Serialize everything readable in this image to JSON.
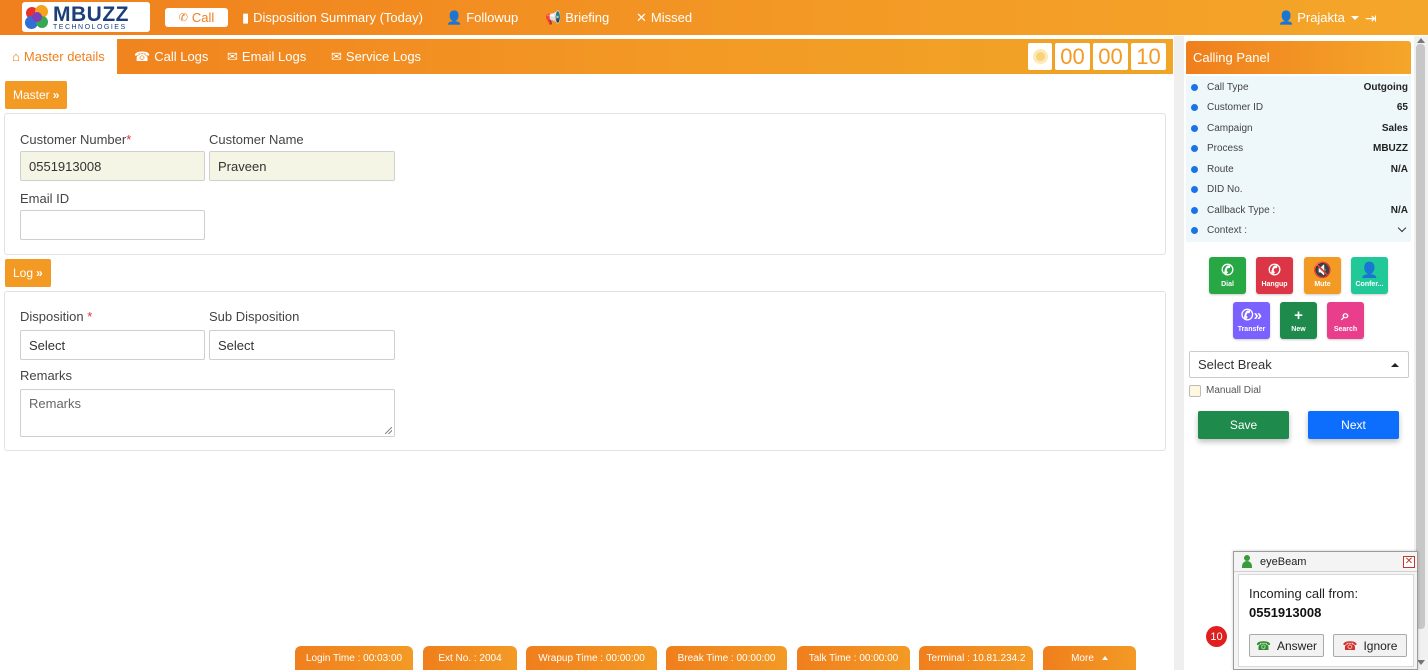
{
  "topbar": {
    "logo_big": "MBUZZ",
    "logo_small": "TECHNOLOGIES",
    "call_label": "Call",
    "nav": {
      "disposition_summary": "Disposition Summary (Today)",
      "followup": "Followup",
      "briefing": "Briefing",
      "missed": "Missed"
    },
    "user_name": "Prajakta"
  },
  "tabs": {
    "master_details": "Master details",
    "call_logs": "Call Logs",
    "email_logs": "Email Logs",
    "service_logs": "Service Logs"
  },
  "timer": {
    "h": "00",
    "m": "00",
    "s": "10"
  },
  "master": {
    "section_label": "Master",
    "customer_number_label": "Customer Number",
    "customer_number_value": "0551913008",
    "customer_name_label": "Customer Name",
    "customer_name_value": "Praveen",
    "email_label": "Email ID",
    "email_value": ""
  },
  "log": {
    "section_label": "Log",
    "disposition_label": "Disposition",
    "disposition_value": "Select",
    "sub_disposition_label": "Sub Disposition",
    "sub_disposition_value": "Select",
    "remarks_label": "Remarks",
    "remarks_placeholder": "Remarks"
  },
  "calling_panel": {
    "title": "Calling Panel",
    "rows": [
      {
        "key": "Call Type",
        "value": "Outgoing"
      },
      {
        "key": "Customer ID",
        "value": "65"
      },
      {
        "key": "Campaign",
        "value": "Sales"
      },
      {
        "key": "Process",
        "value": "MBUZZ"
      },
      {
        "key": "Route",
        "value": "N/A"
      },
      {
        "key": "DID No.",
        "value": ""
      },
      {
        "key": "Callback Type :",
        "value": "N/A"
      },
      {
        "key": "Context :",
        "value": ""
      }
    ],
    "actions": {
      "dial": "Dial",
      "hangup": "Hangup",
      "mute": "Mute",
      "conference": "Confer...",
      "transfer": "Transfer",
      "new": "New",
      "search": "Search"
    },
    "colors": {
      "dial": "#28a745",
      "hangup": "#dc3545",
      "mute": "#f39a25",
      "conference": "#20c997",
      "transfer": "#7b61ff",
      "new": "#1e8a4c",
      "search": "#e83e8c"
    },
    "break_select": "Select Break",
    "manual_dial_label": "Manuall Dial",
    "save_label": "Save",
    "next_label": "Next"
  },
  "eyebeam": {
    "title": "eyeBeam",
    "incoming_label": "Incoming call from:",
    "number": "0551913008",
    "answer_label": "Answer",
    "ignore_label": "Ignore",
    "badge_count": "10"
  },
  "status_bar": {
    "login_time": "Login Time : 00:03:00",
    "ext_no": "Ext No. : 2004",
    "wrapup_time": "Wrapup Time : 00:00:00",
    "break_time": "Break Time : 00:00:00",
    "talk_time": "Talk Time : 00:00:00",
    "terminal": "Terminal : 10.81.234.2",
    "more": "More"
  },
  "theme": {
    "accent": "#f39a25",
    "save": "#1e8a4c",
    "next": "#0d6efd"
  }
}
